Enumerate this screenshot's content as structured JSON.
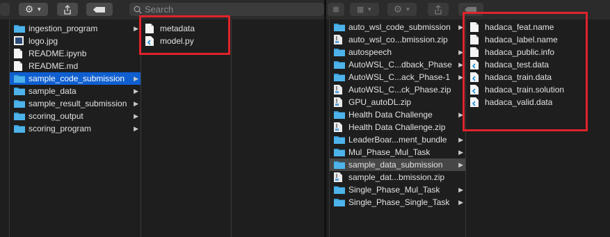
{
  "left": {
    "search_placeholder": "Search",
    "col1": [
      {
        "label": "ingestion_program",
        "type": "folder",
        "chevron": true
      },
      {
        "label": "logo.jpg",
        "type": "image",
        "chevron": false
      },
      {
        "label": "README.ipynb",
        "type": "doc",
        "chevron": false
      },
      {
        "label": "README.md",
        "type": "doc",
        "chevron": false
      },
      {
        "label": "sample_code_submission",
        "type": "folder",
        "chevron": true,
        "selected": true
      },
      {
        "label": "sample_data",
        "type": "folder",
        "chevron": true
      },
      {
        "label": "sample_result_submission",
        "type": "folder",
        "chevron": true
      },
      {
        "label": "scoring_output",
        "type": "folder",
        "chevron": true
      },
      {
        "label": "scoring_program",
        "type": "folder",
        "chevron": true
      }
    ],
    "col2": [
      {
        "label": "metadata",
        "type": "doc"
      },
      {
        "label": "model.py",
        "type": "code"
      }
    ]
  },
  "right": {
    "col1": [
      {
        "label": "auto_wsl_code_submission",
        "type": "folder",
        "chevron": true
      },
      {
        "label": "auto_wsl_co...bmission.zip",
        "type": "zip",
        "chevron": false
      },
      {
        "label": "autospeech",
        "type": "folder",
        "chevron": true
      },
      {
        "label": "AutoWSL_C...dback_Phase",
        "type": "folder",
        "chevron": true
      },
      {
        "label": "AutoWSL_C...ack_Phase-1",
        "type": "folder",
        "chevron": true
      },
      {
        "label": "AutoWSL_C...ck_Phase.zip",
        "type": "zip",
        "chevron": false
      },
      {
        "label": "GPU_autoDL.zip",
        "type": "zip",
        "chevron": false
      },
      {
        "label": "Health Data Challenge",
        "type": "folder",
        "chevron": true
      },
      {
        "label": "Health Data Challenge.zip",
        "type": "zip",
        "chevron": false
      },
      {
        "label": "LeaderBoar...ment_bundle",
        "type": "folder",
        "chevron": true
      },
      {
        "label": "Mul_Phase_Mul_Task",
        "type": "folder",
        "chevron": true
      },
      {
        "label": "sample_data_submission",
        "type": "folder",
        "chevron": true,
        "selected": true
      },
      {
        "label": "sample_dat...bmission.zip",
        "type": "zip",
        "chevron": false
      },
      {
        "label": "Single_Phase_Mul_Task",
        "type": "folder",
        "chevron": true
      },
      {
        "label": "Single_Phase_Single_Task",
        "type": "folder",
        "chevron": true
      }
    ],
    "col2": [
      {
        "label": "hadaca_feat.name",
        "type": "doc"
      },
      {
        "label": "hadaca_label.name",
        "type": "doc"
      },
      {
        "label": "hadaca_public.info",
        "type": "doc"
      },
      {
        "label": "hadaca_test.data",
        "type": "code"
      },
      {
        "label": "hadaca_train.data",
        "type": "code"
      },
      {
        "label": "hadaca_train.solution",
        "type": "code"
      },
      {
        "label": "hadaca_valid.data",
        "type": "code"
      }
    ]
  },
  "colors": {
    "highlight": "#e0232b",
    "selection": "#0f5fd0",
    "folder": "#3aa0d8"
  }
}
